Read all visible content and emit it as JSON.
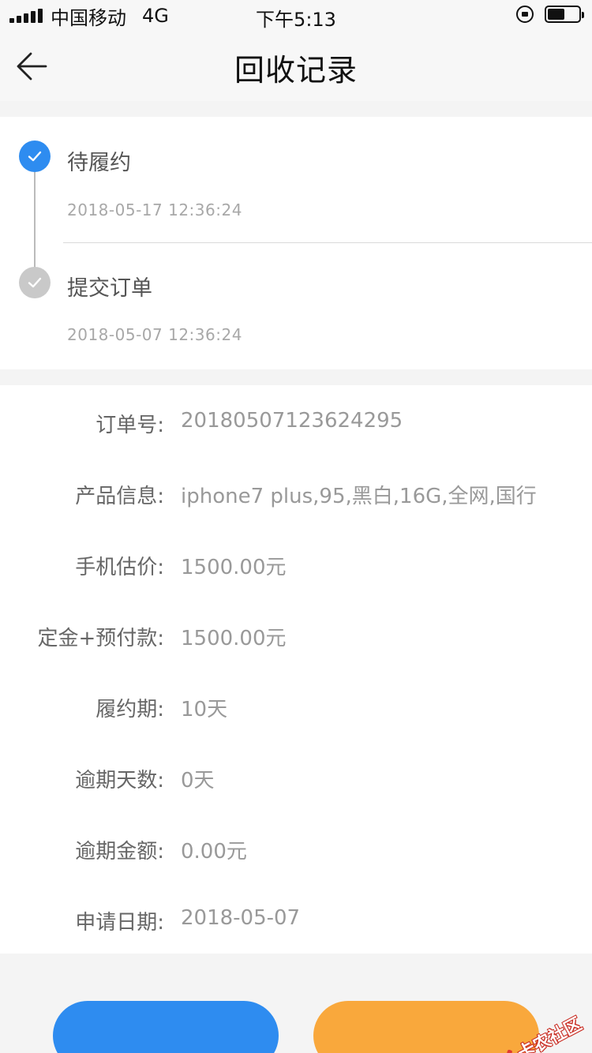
{
  "status_bar": {
    "carrier": "中国移动",
    "network": "4G",
    "time": "下午5:13"
  },
  "nav": {
    "title": "回收记录",
    "back_icon": "arrow-left-icon"
  },
  "timeline": [
    {
      "title": "待履约",
      "time": "2018-05-17 12:36:24",
      "state": "active",
      "icon": "check-icon"
    },
    {
      "title": "提交订单",
      "time": "2018-05-07 12:36:24",
      "state": "done",
      "icon": "check-icon"
    }
  ],
  "details": [
    {
      "label": "订单号:",
      "value": "20180507123624295"
    },
    {
      "label": "产品信息:",
      "value": "iphone7 plus,95,黑白,16G,全网,国行"
    },
    {
      "label": "手机估价:",
      "value": "1500.00元"
    },
    {
      "label": "定金+预付款:",
      "value": "1500.00元"
    },
    {
      "label": "履约期:",
      "value": "10天"
    },
    {
      "label": "逾期天数:",
      "value": "0天"
    },
    {
      "label": "逾期金额:",
      "value": "0.00元"
    },
    {
      "label": "申请日期:",
      "value": "2018-05-07"
    }
  ],
  "buttons": {
    "left_label": "",
    "right_label": ""
  },
  "watermark": {
    "text": "卡农社区"
  },
  "colors": {
    "accent_blue": "#2e8cf0",
    "accent_orange": "#f9a83c",
    "watermark_red": "#e03a2f"
  }
}
